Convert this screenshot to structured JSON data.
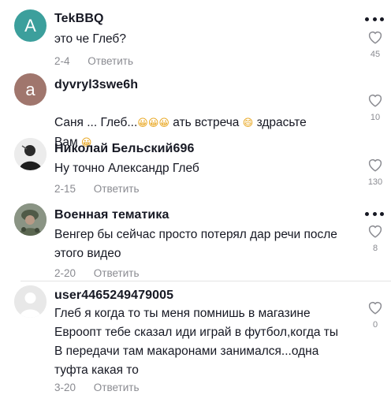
{
  "reply_label": "Ответить",
  "comments": [
    {
      "username": "TekBBQ",
      "avatar_letter": "A",
      "avatar_color": "#3c9f9c",
      "text": "это че Глеб?",
      "date": "2-4",
      "likes": "45"
    },
    {
      "username": "dyvryl3swe6h",
      "avatar_letter": "a",
      "avatar_color": "#a0766d",
      "text_part1": "Саня ... Глеб...",
      "text_part2": "  ",
      "text_part3": "ать встреча ",
      "text_part4": " здрасьте",
      "text_line2": "Вам ",
      "date": "",
      "likes": "10"
    },
    {
      "username": "Николай Бельский696",
      "avatar_icon": "person-photo-avatar",
      "text": "Ну точно Александр Глеб",
      "date": "2-15",
      "likes": "130"
    },
    {
      "username": "Военная тематика",
      "avatar_icon": "military-photo-avatar",
      "text": "Венгер бы сейчас просто потерял дар речи после\nэтого видео",
      "date": "2-20",
      "likes": "8"
    },
    {
      "username": "user4465249479005",
      "avatar_icon": "default-user-avatar",
      "text": "Глеб я когда то ты меня помнишь в магазине\nЕвроопт тебе сказал иди играй в футбол,когда ты\nВ передачи там макаронами занимался...одна\nтуфта какая то",
      "date": "3-20",
      "likes": "0"
    }
  ],
  "emoji": {
    "grin": "😀",
    "laugh": "😄"
  }
}
